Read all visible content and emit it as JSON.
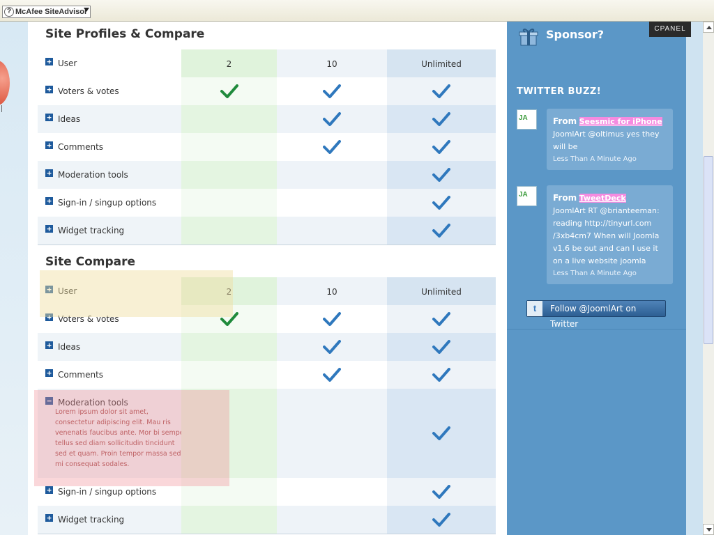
{
  "toolbar": {
    "siteadvisor_label": "McAfee SiteAdvisor"
  },
  "cpanel_label": "CPANEL",
  "sections": [
    {
      "title": "Site Profiles & Compare",
      "header": {
        "label": "User",
        "plans": [
          "2",
          "10",
          "Unlimited"
        ]
      },
      "rows": [
        {
          "label": "Voters & votes",
          "checks": [
            true,
            true,
            true
          ]
        },
        {
          "label": "Ideas",
          "checks": [
            false,
            true,
            true
          ]
        },
        {
          "label": "Comments",
          "checks": [
            false,
            true,
            true
          ]
        },
        {
          "label": "Moderation tools",
          "checks": [
            false,
            false,
            true
          ]
        },
        {
          "label": "Sign-in / singup options",
          "checks": [
            false,
            false,
            true
          ]
        },
        {
          "label": "Widget tracking",
          "checks": [
            false,
            false,
            true
          ]
        }
      ]
    },
    {
      "title": "Site Compare",
      "header": {
        "label": "User",
        "plans": [
          "2",
          "10",
          "Unlimited"
        ]
      },
      "rows": [
        {
          "label": "Voters & votes",
          "checks": [
            true,
            true,
            true
          ]
        },
        {
          "label": "Ideas",
          "checks": [
            false,
            true,
            true
          ]
        },
        {
          "label": "Comments",
          "checks": [
            false,
            true,
            true
          ]
        },
        {
          "label": "Moderation tools",
          "checks": [
            false,
            false,
            true
          ],
          "expanded": true,
          "description": "Lorem ipsum dolor sit amet, consectetur adipiscing elit. Mau ris venenatis faucibus ante. Mor bi semper tellus sed diam sollicitudin tincidunt sed et quam. Proin tempor massa sed mi consequat sodales."
        },
        {
          "label": "Sign-in / singup options",
          "checks": [
            false,
            false,
            true
          ]
        },
        {
          "label": "Widget tracking",
          "checks": [
            false,
            false,
            true
          ]
        }
      ]
    }
  ],
  "sidebar": {
    "sponsor_title": "Sponsor?",
    "buzz_title": "TWITTER BUZZ!",
    "tweets": [
      {
        "from_prefix": "From",
        "source": "Seesmic for iPhone",
        "text": "JoomlArt @oltimus yes they will be",
        "time": "Less Than A Minute Ago",
        "avatar_text": "JA"
      },
      {
        "from_prefix": "From",
        "source": "TweetDeck",
        "text": "JoomlArt RT @brianteeman: reading http://tinyurl.com /3xb4cm7 When will Joomla v1.6 be out and can I use it on a live website joomla",
        "time": "Less Than A Minute Ago",
        "avatar_text": "JA"
      }
    ],
    "follow_label": "Follow @JoomlArt on Twitter"
  },
  "colors": {
    "check_green": "#1f8a3b",
    "check_blue": "#2f78bd",
    "sidebar_bg": "#5b97c7",
    "highlight_pink": "#f58be0"
  }
}
